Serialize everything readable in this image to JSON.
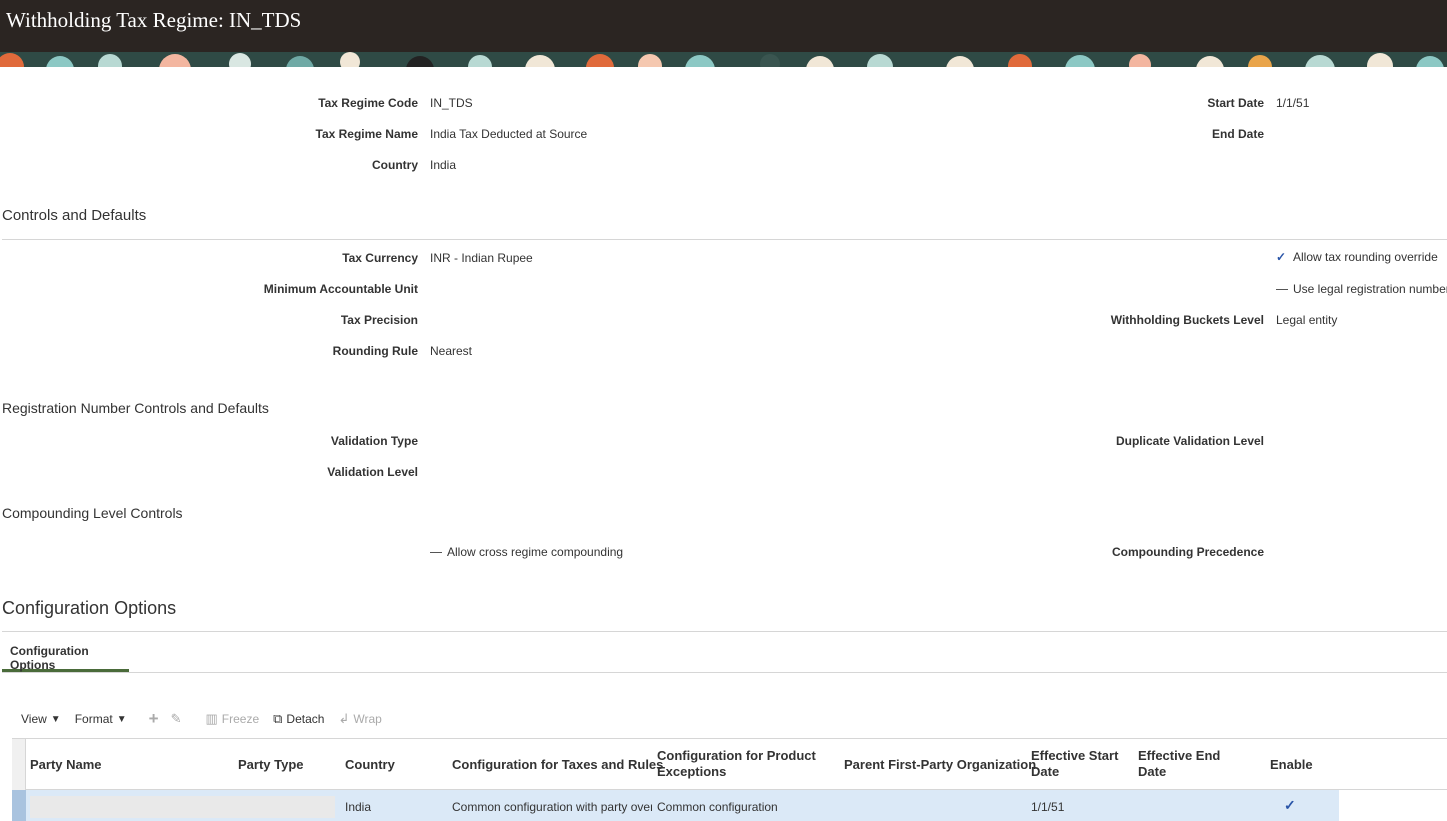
{
  "header": {
    "title": "Withholding Tax Regime: IN_TDS"
  },
  "regime": {
    "code_label": "Tax Regime Code",
    "code_value": "IN_TDS",
    "name_label": "Tax Regime Name",
    "name_value": "India Tax Deducted at Source",
    "country_label": "Country",
    "country_value": "India",
    "start_label": "Start Date",
    "start_value": "1/1/51",
    "end_label": "End Date"
  },
  "controls": {
    "title": "Controls and Defaults",
    "currency_label": "Tax Currency",
    "currency_value": "INR - Indian Rupee",
    "mau_label": "Minimum Accountable Unit",
    "precision_label": "Tax Precision",
    "rounding_label": "Rounding Rule",
    "rounding_value": "Nearest",
    "rounding_override_label": "Allow tax rounding override",
    "rounding_override_checked": true,
    "legal_reg_label": "Use legal registration number",
    "legal_reg_checked": false,
    "buckets_label": "Withholding Buckets Level",
    "buckets_value": "Legal entity"
  },
  "registration": {
    "title": "Registration Number Controls and Defaults",
    "validation_type_label": "Validation Type",
    "validation_level_label": "Validation Level",
    "duplicate_label": "Duplicate Validation Level"
  },
  "compounding": {
    "title": "Compounding Level Controls",
    "cross_label": "Allow cross regime compounding",
    "cross_checked": false,
    "precedence_label": "Compounding Precedence"
  },
  "config": {
    "title": "Configuration Options",
    "tab_label": "Configuration Options",
    "toolbar": {
      "view": "View",
      "format": "Format",
      "freeze": "Freeze",
      "detach": "Detach",
      "wrap": "Wrap"
    },
    "columns": {
      "party_name": "Party Name",
      "party_type": "Party Type",
      "country": "Country",
      "taxes_rules": "Configuration for Taxes and Rules",
      "product_exceptions": "Configuration for Product Exceptions",
      "parent_org": "Parent First-Party Organization",
      "eff_start": "Effective Start Date",
      "eff_end": "Effective End Date",
      "enable": "Enable"
    },
    "rows": [
      {
        "country": "India",
        "taxes_rules": "Common configuration with party overr...",
        "product_exceptions": "Common configuration",
        "eff_start": "1/1/51",
        "enable": "✓"
      }
    ]
  },
  "colors": {
    "header_bg": "#2b2522",
    "selected_row": "#dbe9f7",
    "tab_underline": "#4a6b3a",
    "check": "#2a55a8"
  }
}
